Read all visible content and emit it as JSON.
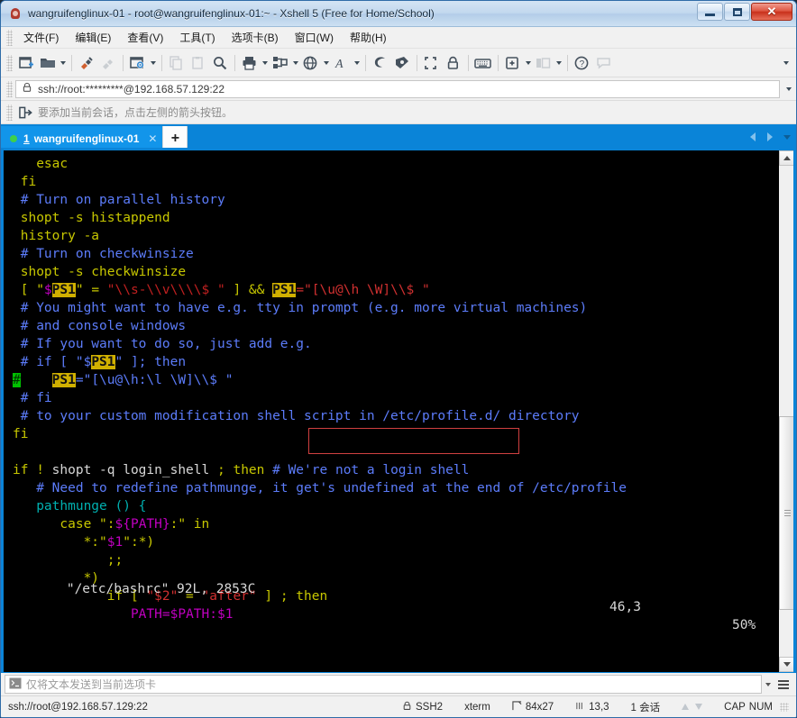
{
  "window": {
    "title": "wangruifenglinux-01 - root@wangruifenglinux-01:~ - Xshell 5 (Free for Home/School)",
    "icon": "xshell-app-icon",
    "minimize_label": "–",
    "maximize_label": "□",
    "close_label": "✕"
  },
  "menubar": {
    "items": [
      {
        "label": "文件(F)",
        "name": "file"
      },
      {
        "label": "编辑(E)",
        "name": "edit"
      },
      {
        "label": "查看(V)",
        "name": "view"
      },
      {
        "label": "工具(T)",
        "name": "tools"
      },
      {
        "label": "选项卡(B)",
        "name": "tabs"
      },
      {
        "label": "窗口(W)",
        "name": "window"
      },
      {
        "label": "帮助(H)",
        "name": "help"
      }
    ]
  },
  "toolbar": {
    "icons": [
      "new-session-icon",
      "open-folder-icon",
      "connect-icon",
      "disconnect-icon",
      "properties-gear-icon",
      "copy-icon",
      "paste-icon",
      "find-icon",
      "print-icon",
      "transfer-icon",
      "globe-icon",
      "font-icon",
      "sftp-icon",
      "ftp-icon",
      "fullscreen-icon",
      "lock-icon",
      "keyboard-icon",
      "new-note-icon",
      "layout-icon",
      "help-icon",
      "chat-icon"
    ],
    "overflow_label": "▾"
  },
  "address": {
    "icon": "lock-icon",
    "value": "ssh://root:*********@192.168.57.129:22",
    "dropdown": "▾"
  },
  "hint": {
    "icon": "add-session-arrow-icon",
    "text": "要添加当前会话，点击左侧的箭头按钮。"
  },
  "tabs": {
    "items": [
      {
        "index": "1",
        "label": "wangruifenglinux-01",
        "close": "✕",
        "status": "connected"
      }
    ],
    "add_label": "+",
    "nav_prev": "◀",
    "nav_next": "▶",
    "nav_menu": "▾"
  },
  "terminal": {
    "rows": 27,
    "cols": 84,
    "lines": [
      [
        {
          "t": "   esac",
          "c": "c-yellow"
        }
      ],
      [
        {
          "t": " fi",
          "c": "c-yellow"
        }
      ],
      [
        {
          "t": " # Turn on parallel history",
          "c": "c-blue"
        }
      ],
      [
        {
          "t": " shopt -s histappend",
          "c": "c-yellow"
        }
      ],
      [
        {
          "t": " history -a",
          "c": "c-yellow"
        }
      ],
      [
        {
          "t": " # Turn on checkwinsize",
          "c": "c-blue"
        }
      ],
      [
        {
          "t": " shopt -s checkwinsize",
          "c": "c-yellow"
        }
      ],
      [
        {
          "t": " [ \"",
          "c": "c-yellow"
        },
        {
          "t": "$",
          "c": "c-magenta"
        },
        {
          "t": "PS1",
          "c": "hl"
        },
        {
          "t": "\" = ",
          "c": "c-yellow"
        },
        {
          "t": "\"\\\\s-\\\\v\\\\\\\\$ \"",
          "c": "c-red"
        },
        {
          "t": " ] && ",
          "c": "c-yellow"
        },
        {
          "t": "PS1",
          "c": "hl"
        },
        {
          "t": "=",
          "c": "c-red2"
        },
        {
          "t": "\"[\\u@\\h \\W]\\\\$ \"",
          "c": "c-red2"
        }
      ],
      [
        {
          "t": " # You might want to have e.g. tty in prompt (e.g. more virtual machines)",
          "c": "c-blue"
        }
      ],
      [
        {
          "t": " # and console windows",
          "c": "c-blue"
        }
      ],
      [
        {
          "t": " # If you want to do so, just add e.g.",
          "c": "c-blue"
        }
      ],
      [
        {
          "t": " # if [ \"$",
          "c": "c-blue"
        },
        {
          "t": "PS1",
          "c": "hl"
        },
        {
          "t": "\" ]; then",
          "c": "c-blue"
        }
      ],
      [
        {
          "t": "#",
          "c": "cursor-blk"
        },
        {
          "t": "    ",
          "c": "c-blue"
        },
        {
          "t": "PS1",
          "c": "hl"
        },
        {
          "t": "=\"[\\u@\\h:\\l \\W]\\\\$ \"",
          "c": "c-blue"
        }
      ],
      [
        {
          "t": " # fi",
          "c": "c-blue"
        }
      ],
      [
        {
          "t": " # to your custom modification shell script in /etc/profile.d/ directory",
          "c": "c-blue"
        }
      ],
      [
        {
          "t": "fi",
          "c": "c-yellow"
        }
      ],
      [
        {
          "t": "",
          "c": "c-white"
        }
      ],
      [
        {
          "t": "if ! ",
          "c": "c-yellow"
        },
        {
          "t": "shopt -q login_shell",
          "c": "c-white"
        },
        {
          "t": " ; ",
          "c": "c-yellow"
        },
        {
          "t": "then",
          "c": "c-yellow"
        },
        {
          "t": " # We're not a login shell",
          "c": "c-blue"
        }
      ],
      [
        {
          "t": "   # Need to redefine pathmunge, it get's undefined at the end of /etc/profile",
          "c": "c-blue"
        }
      ],
      [
        {
          "t": "   pathmunge () {",
          "c": "c-cyan"
        }
      ],
      [
        {
          "t": "      case ",
          "c": "c-yellow"
        },
        {
          "t": "\":",
          "c": "c-yellow"
        },
        {
          "t": "${PATH}",
          "c": "c-magenta"
        },
        {
          "t": ":\"",
          "c": "c-yellow"
        },
        {
          "t": " in",
          "c": "c-yellow"
        }
      ],
      [
        {
          "t": "         *:\"",
          "c": "c-yellow"
        },
        {
          "t": "$1",
          "c": "c-magenta"
        },
        {
          "t": "\":*)",
          "c": "c-yellow"
        }
      ],
      [
        {
          "t": "            ;;",
          "c": "c-yellow"
        }
      ],
      [
        {
          "t": "         *)",
          "c": "c-yellow"
        }
      ],
      [
        {
          "t": "            if [ ",
          "c": "c-yellow"
        },
        {
          "t": "\"$2\"",
          "c": "c-red2"
        },
        {
          "t": " = ",
          "c": "c-yellow"
        },
        {
          "t": "\"after\"",
          "c": "c-red2"
        },
        {
          "t": " ] ; ",
          "c": "c-yellow"
        },
        {
          "t": "then",
          "c": "c-yellow"
        }
      ],
      [
        {
          "t": "               PATH=",
          "c": "c-magenta"
        },
        {
          "t": "$PATH",
          "c": "c-magenta"
        },
        {
          "t": ":",
          "c": "c-magenta"
        },
        {
          "t": "$1",
          "c": "c-magenta"
        }
      ]
    ],
    "vim_status": {
      "file": "\"/etc/bashrc\" 92L, 2853C",
      "position": "46,3",
      "percent": "50%"
    },
    "highlight_box": "PS1=\"[\\u@\\h \\W]\\\\$ \"",
    "colors": {
      "background": "#000000",
      "comment": "#5c7cfa",
      "keyword": "#c8c800",
      "string": "#c02020",
      "variable": "#c000c0",
      "search_highlight": "#d0b000",
      "cursor": "#00c000"
    }
  },
  "sendbar": {
    "icon": "terminal-prompt-icon",
    "placeholder": "仅将文本发送到当前选项卡",
    "value": "",
    "dropdown": "▾",
    "menu_icon": "hamburger-icon"
  },
  "statusbar": {
    "connection": "ssh://root@192.168.57.129:22",
    "protocol_icon": "lock-icon",
    "protocol": "SSH2",
    "term_type": "xterm",
    "size_icon": "resize-icon",
    "size": "84x27",
    "cursor_icon": "cursor-pos-icon",
    "cursor": "13,3",
    "sessions": "1 会话",
    "upload_icon": "arrow-up-icon",
    "download_icon": "arrow-down-icon",
    "caps": "CAP",
    "num": "NUM"
  }
}
